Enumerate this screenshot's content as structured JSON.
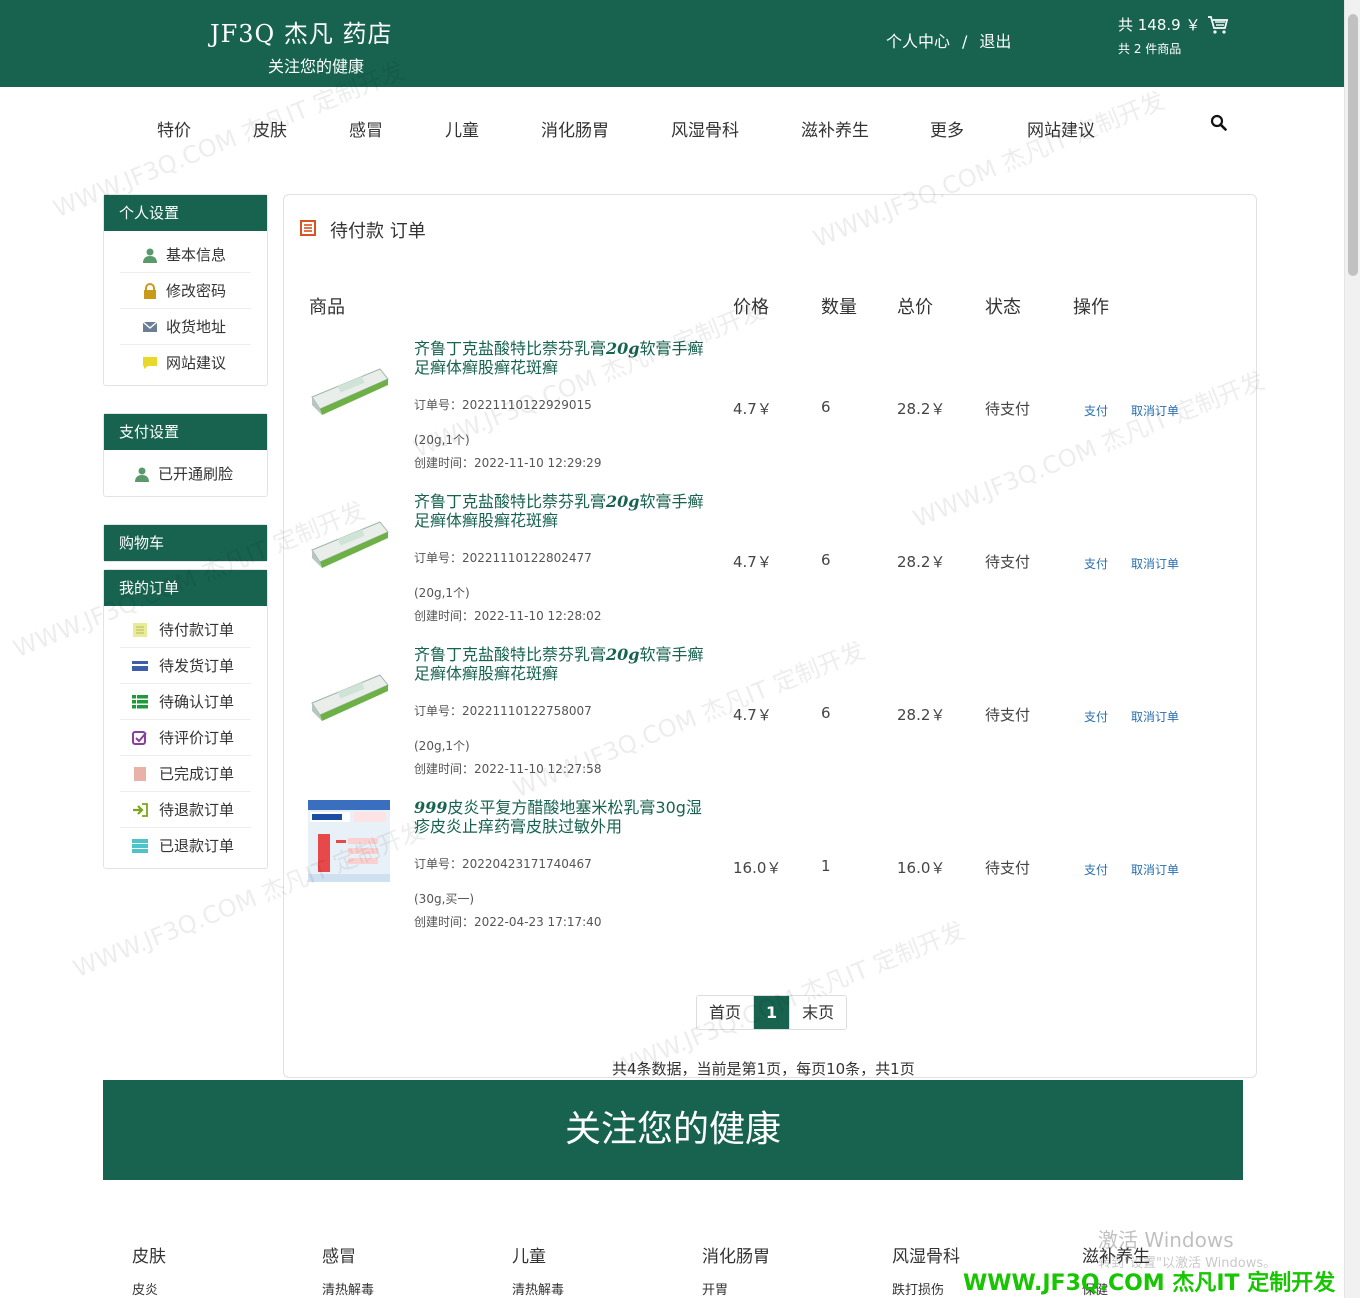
{
  "header": {
    "logo_title": "JF3Q 杰凡 药店",
    "logo_sub": "关注您的健康",
    "user_center": "个人中心",
    "sep": "/",
    "logout": "退出",
    "cart_total": "共 148.9 ￥",
    "cart_count": "共 2 件商品"
  },
  "nav": [
    "特价",
    "皮肤",
    "感冒",
    "儿童",
    "消化肠胃",
    "风湿骨科",
    "滋补养生",
    "更多",
    "网站建议"
  ],
  "sidebar": {
    "personal": {
      "title": "个人设置",
      "items": [
        "基本信息",
        "修改密码",
        "收货地址",
        "网站建议"
      ]
    },
    "payment": {
      "title": "支付设置",
      "items": [
        "已开通刷脸"
      ]
    },
    "cart": {
      "title": "购物车"
    },
    "orders": {
      "title": "我的订单",
      "items": [
        "待付款订单",
        "待发货订单",
        "待确认订单",
        "待评价订单",
        "已完成订单",
        "待退款订单",
        "已退款订单"
      ]
    }
  },
  "main": {
    "title": "待付款 订单",
    "columns": [
      "商品",
      "价格",
      "数量",
      "总价",
      "状态",
      "操作"
    ],
    "orders": [
      {
        "name_a": "齐鲁丁克盐酸特比萘芬乳膏",
        "name_b": "20g",
        "name_c": "软膏手癣足癣体癣股癣花斑癣",
        "order_no": "订单号：20221110122929015",
        "spec": "(20g,1个)",
        "created": "创建时间：2022-11-10 12:29:29",
        "price": "4.7￥",
        "qty": "6",
        "total": "28.2￥",
        "status": "待支付",
        "pay": "支付",
        "cancel": "取消订单"
      },
      {
        "name_a": "齐鲁丁克盐酸特比萘芬乳膏",
        "name_b": "20g",
        "name_c": "软膏手癣足癣体癣股癣花斑癣",
        "order_no": "订单号：20221110122802477",
        "spec": "(20g,1个)",
        "created": "创建时间：2022-11-10 12:28:02",
        "price": "4.7￥",
        "qty": "6",
        "total": "28.2￥",
        "status": "待支付",
        "pay": "支付",
        "cancel": "取消订单"
      },
      {
        "name_a": "齐鲁丁克盐酸特比萘芬乳膏",
        "name_b": "20g",
        "name_c": "软膏手癣足癣体癣股癣花斑癣",
        "order_no": "订单号：20221110122758007",
        "spec": "(20g,1个)",
        "created": "创建时间：2022-11-10 12:27:58",
        "price": "4.7￥",
        "qty": "6",
        "total": "28.2￥",
        "status": "待支付",
        "pay": "支付",
        "cancel": "取消订单"
      },
      {
        "name_a": "",
        "name_b": "999",
        "name_c": "皮炎平复方醋酸地塞米松乳膏30g湿疹皮炎止痒药膏皮肤过敏外用",
        "order_no": "订单号：20220423171740467",
        "spec": "(30g,买一)",
        "created": "创建时间：2022-04-23 17:17:40",
        "price": "16.0￥",
        "qty": "1",
        "total": "16.0￥",
        "status": "待支付",
        "pay": "支付",
        "cancel": "取消订单"
      }
    ],
    "pager": {
      "first": "首页",
      "current": "1",
      "last": "末页"
    },
    "pager_info": "共4条数据，当前是第1页，每页10条，共1页"
  },
  "footer": {
    "banner": "关注您的健康",
    "cats": [
      {
        "title": "皮肤",
        "sub": "皮炎"
      },
      {
        "title": "感冒",
        "sub": "清热解毒"
      },
      {
        "title": "儿童",
        "sub": "清热解毒"
      },
      {
        "title": "消化肠胃",
        "sub": "开胃"
      },
      {
        "title": "风湿骨科",
        "sub": "跌打损伤"
      },
      {
        "title": "滋补养生",
        "sub": "保健"
      }
    ]
  },
  "overlay": {
    "activate": "激活 Windows",
    "activate_sub": "转到\"设置\"以激活 Windows。",
    "brand": "WWW.JF3Q.COM 杰凡IT  定制开发",
    "watermark": "WWW.JF3Q.COM 杰凡IT 定制开发"
  },
  "colors": {
    "brand": "#17634f",
    "link": "#2a6fb0"
  }
}
